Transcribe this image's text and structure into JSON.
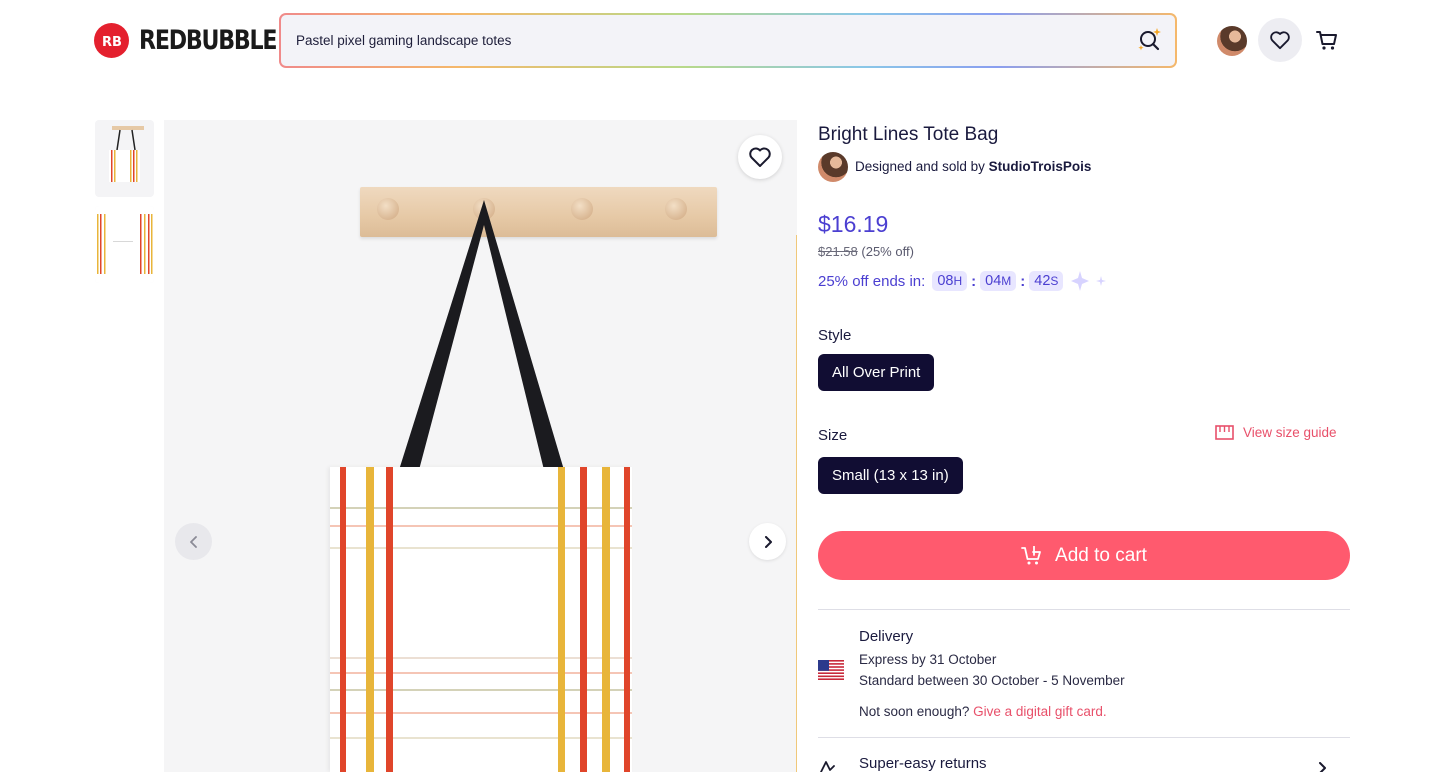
{
  "header": {
    "logo_text": "REDBUBBLE",
    "search": {
      "value": "Pastel pixel gaming landscape totes"
    }
  },
  "product": {
    "title": "Bright Lines Tote Bag",
    "seller_prefix": "Designed and sold by",
    "seller_name": "StudioTroisPois",
    "price": "$16.19",
    "original_price": "$21.58",
    "discount": "(25% off)",
    "countdown": {
      "label": "25% off ends in:",
      "hours": "08",
      "hours_unit": "H",
      "minutes": "04",
      "minutes_unit": "M",
      "seconds": "42",
      "seconds_unit": "S"
    },
    "style": {
      "label": "Style",
      "selected": "All Over Print"
    },
    "size": {
      "label": "Size",
      "selected": "Small (13 x 13 in)",
      "guide_label": "View size guide"
    },
    "add_to_cart": "Add to cart"
  },
  "delivery": {
    "title": "Delivery",
    "express": "Express by 31 October",
    "standard": "Standard between 30 October - 5 November",
    "not_soon": "Not soon enough?",
    "gift_link": "Give a digital gift card."
  },
  "returns": {
    "title": "Super-easy returns"
  },
  "colors": {
    "brand_red": "#e4202e",
    "price_purple": "#4b3fd1",
    "cart_button": "#ff5a6e",
    "chip_dark": "#110d33",
    "link_pink": "#e8506a"
  },
  "icons": [
    "search-sparkle-icon",
    "heart-icon",
    "cart-icon",
    "chevron-left-icon",
    "chevron-right-icon",
    "ruler-icon",
    "add-cart-icon",
    "us-flag-icon",
    "returns-icon",
    "sparkle-icon"
  ]
}
